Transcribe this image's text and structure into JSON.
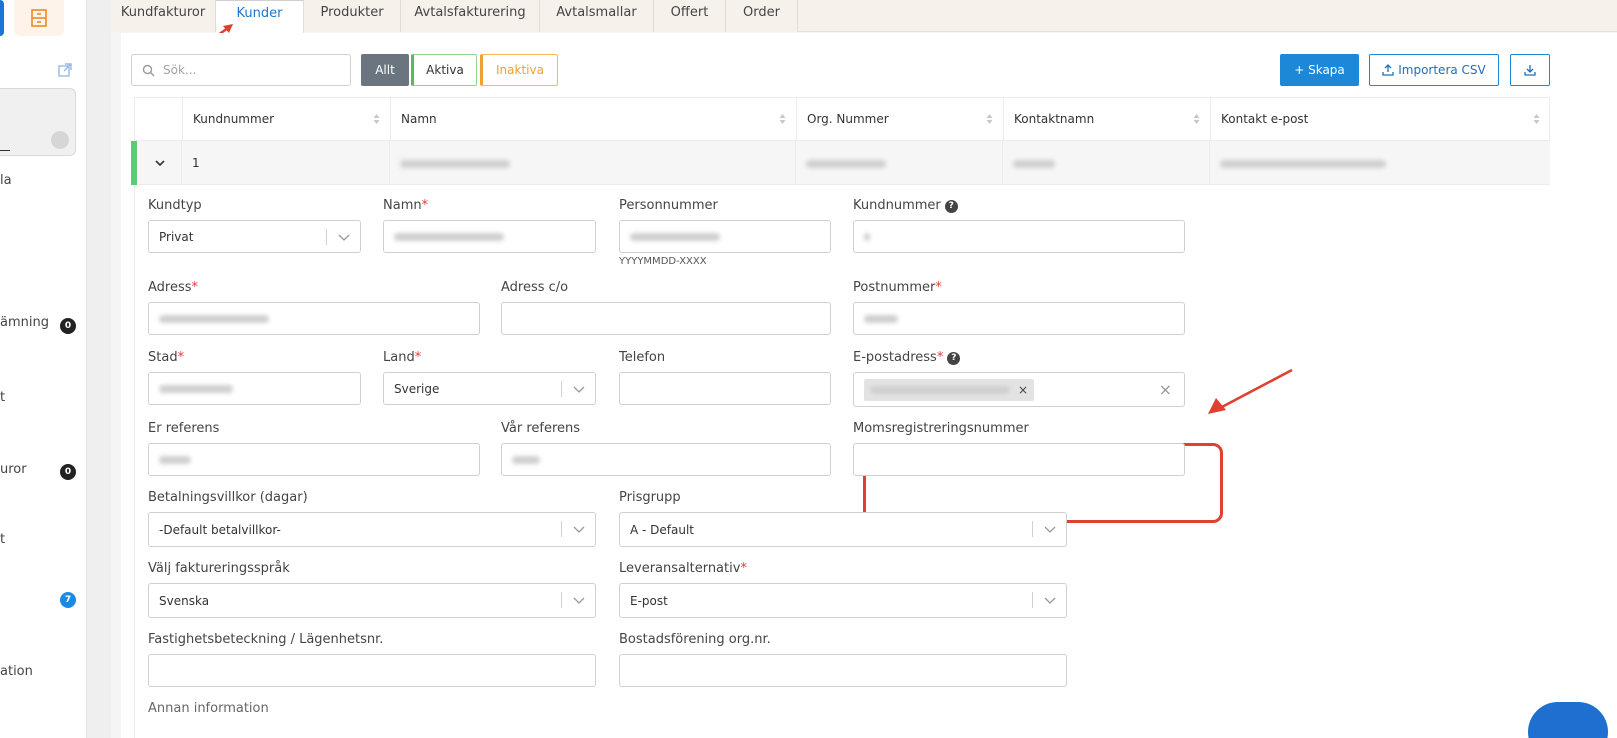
{
  "sidebar": {
    "labels": [
      "la",
      "ämning",
      "t",
      "uror",
      "t",
      "ation"
    ],
    "badges": [
      "0",
      "0",
      "7"
    ]
  },
  "tabs": [
    "Kundfakturor",
    "Kunder",
    "Produkter",
    "Avtalsfakturering",
    "Avtalsmallar",
    "Offert",
    "Order"
  ],
  "active_tab": "Kunder",
  "toolbar": {
    "search_placeholder": "Sök...",
    "filter_all": "Allt",
    "filter_active": "Aktiva",
    "filter_inactive": "Inaktiva",
    "create_label": "+ Skapa",
    "import_label": "Importera CSV"
  },
  "table": {
    "headers": [
      "Kundnummer",
      "Namn",
      "Org. Nummer",
      "Kontaktnamn",
      "Kontakt e-post"
    ],
    "row": {
      "kundnummer": "1"
    }
  },
  "form": {
    "kundtyp_label": "Kundtyp",
    "kundtyp_value": "Privat",
    "namn_label": "Namn",
    "personnummer_label": "Personnummer",
    "personnummer_hint": "YYYYMMDD-XXXX",
    "kundnummer_label": "Kundnummer",
    "adress_label": "Adress",
    "adress_co_label": "Adress c/o",
    "postnummer_label": "Postnummer",
    "stad_label": "Stad",
    "land_label": "Land",
    "land_value": "Sverige",
    "telefon_label": "Telefon",
    "epost_label": "E-postadress",
    "er_referens_label": "Er referens",
    "var_referens_label": "Vår referens",
    "moms_label": "Momsregistreringsnummer",
    "betalningsvillkor_label": "Betalningsvillkor (dagar)",
    "betalningsvillkor_value": "-Default betalvillkor-",
    "prisgrupp_label": "Prisgrupp",
    "prisgrupp_value": "A - Default",
    "sprak_label": "Välj faktureringsspråk",
    "sprak_value": "Svenska",
    "leverans_label": "Leveransalternativ",
    "leverans_value": "E-post",
    "fastighet_label": "Fastighetsbeteckning / Lägenhetsnr.",
    "bostad_label": "Bostadsförening org.nr.",
    "annan_label": "Annan information"
  },
  "colors": {
    "accent": "#1e88d8",
    "active_green": "#5cb85c",
    "inactive_orange": "#f0a030",
    "annotation_red": "#e0402f"
  }
}
